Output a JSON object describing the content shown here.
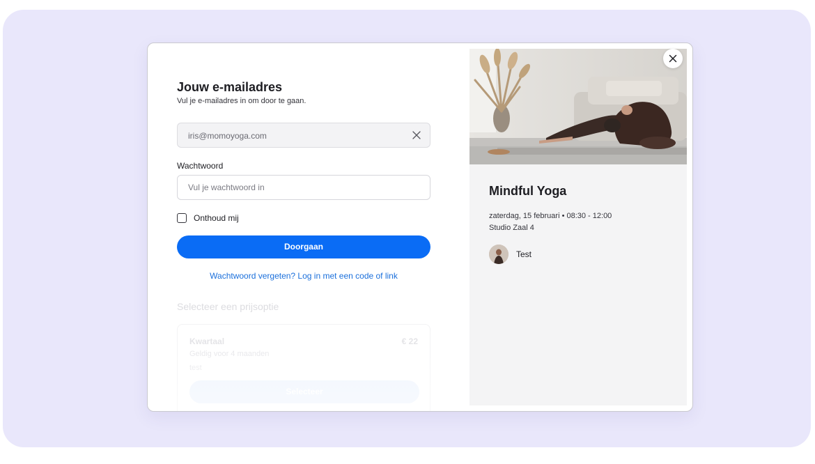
{
  "login": {
    "title": "Jouw e-mailadres",
    "subtitle": "Vul je e-mailadres in om door te gaan.",
    "email_value": "iris@momoyoga.com",
    "password_label": "Wachtwoord",
    "password_placeholder": "Vul je wachtwoord in",
    "remember_label": "Onthoud mij",
    "continue_label": "Doorgaan",
    "forgot_link": "Wachtwoord vergeten? Log in met een code of link"
  },
  "pricing": {
    "heading": "Selecteer een prijsoptie",
    "options": [
      {
        "name": "Kwartaal",
        "price": "€ 22",
        "validity": "Geldig voor 4 maanden",
        "description": "test",
        "button_label": "Selecteer"
      }
    ]
  },
  "event": {
    "title": "Mindful Yoga",
    "datetime": "zaterdag, 15 februari • 08:30 - 12:00",
    "location": "Studio Zaal 4",
    "teacher_name": "Test"
  },
  "icons": {
    "clear": "close-icon",
    "close_modal": "close-icon",
    "checkbox": "checkbox-unchecked-icon"
  },
  "colors": {
    "accent": "#0a6cf5",
    "link": "#1a6fdb",
    "backdrop": "#e9e7fb",
    "panel": "#f4f4f5"
  }
}
